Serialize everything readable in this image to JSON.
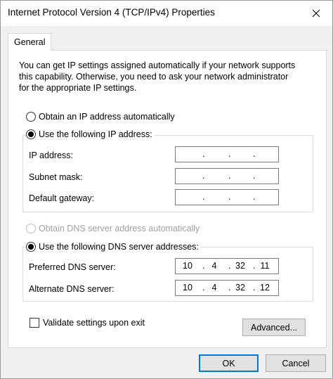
{
  "window": {
    "title": "Internet Protocol Version 4 (TCP/IPv4) Properties"
  },
  "tabs": [
    {
      "label": "General",
      "selected": true
    }
  ],
  "description": [
    "You can get IP settings assigned automatically if your network supports",
    "this capability. Otherwise, you need to ask your network administrator",
    "for the appropriate IP settings."
  ],
  "ip": {
    "auto_label": "Obtain an IP address automatically",
    "auto_selected": false,
    "manual_label": "Use the following IP address:",
    "manual_selected": true,
    "fields": {
      "ip_address": {
        "label": "IP address:",
        "segments": [
          "",
          "",
          "",
          ""
        ]
      },
      "subnet_mask": {
        "label": "Subnet mask:",
        "segments": [
          "",
          "",
          "",
          ""
        ]
      },
      "default_gateway": {
        "label": "Default gateway:",
        "segments": [
          "",
          "",
          "",
          ""
        ]
      }
    }
  },
  "dns": {
    "auto_label": "Obtain DNS server address automatically",
    "auto_selected": false,
    "auto_disabled": true,
    "manual_label": "Use the following DNS server addresses:",
    "manual_selected": true,
    "fields": {
      "preferred": {
        "label": "Preferred DNS server:",
        "segments": [
          "10",
          "4",
          "32",
          "11"
        ]
      },
      "alternate": {
        "label": "Alternate DNS server:",
        "segments": [
          "10",
          "4",
          "32",
          "12"
        ]
      }
    }
  },
  "validate": {
    "label": "Validate settings upon exit",
    "checked": false
  },
  "buttons": {
    "advanced": "Advanced...",
    "ok": "OK",
    "cancel": "Cancel"
  },
  "colors": {
    "accent": "#0078d7",
    "disabled_text": "#a0a0a0"
  }
}
